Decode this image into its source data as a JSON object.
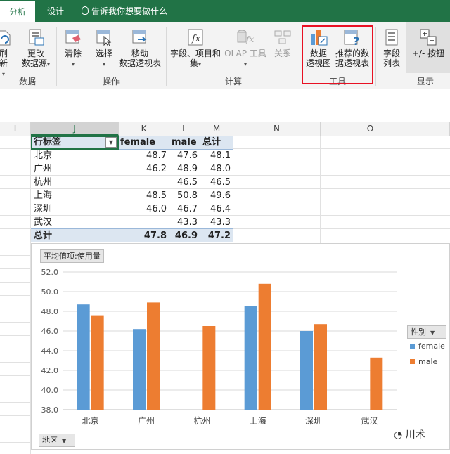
{
  "ribbon": {
    "tabs": {
      "analyze": "分析",
      "design": "设计"
    },
    "tell_me": "告诉我你想要做什么",
    "buttons": {
      "refresh": "刷新",
      "change_source_1": "更改",
      "change_source_2": "数据源",
      "clear": "清除",
      "select": "选择",
      "move_1": "移动",
      "move_2": "数据透视表",
      "fields_1": "字段、项目和",
      "fields_2": "集",
      "olap": "OLAP 工具",
      "relations": "关系",
      "pivot_chart_1": "数据",
      "pivot_chart_2": "透视图",
      "recommended_1": "推荐的数",
      "recommended_2": "据透视表",
      "field_list_1": "字段",
      "field_list_2": "列表",
      "plus_minus": "+/- 按钮"
    },
    "groups": {
      "data": "数据",
      "actions": "操作",
      "calculations": "计算",
      "tools": "工具",
      "show": "显示"
    }
  },
  "columns": [
    "I",
    "J",
    "K",
    "L",
    "M",
    "N",
    "O"
  ],
  "pivot": {
    "headers": {
      "row_label": "行标签",
      "female": "female",
      "male": "male",
      "total": "总计"
    },
    "rows": [
      {
        "city": "北京",
        "female": "48.7",
        "male": "47.6",
        "total": "48.1"
      },
      {
        "city": "广州",
        "female": "46.2",
        "male": "48.9",
        "total": "48.0"
      },
      {
        "city": "杭州",
        "female": "",
        "male": "46.5",
        "total": "46.5"
      },
      {
        "city": "上海",
        "female": "48.5",
        "male": "50.8",
        "total": "49.6"
      },
      {
        "city": "深圳",
        "female": "46.0",
        "male": "46.7",
        "total": "46.4"
      },
      {
        "city": "武汉",
        "female": "",
        "male": "43.3",
        "total": "43.3"
      }
    ],
    "total_row": {
      "label": "总计",
      "female": "47.8",
      "male": "46.9",
      "total": "47.2"
    }
  },
  "chart": {
    "value_field_button": "平均值项:使用量",
    "legend_field_button": "性别",
    "axis_field_button": "地区"
  },
  "chart_data": {
    "type": "bar",
    "categories": [
      "北京",
      "广州",
      "杭州",
      "上海",
      "深圳",
      "武汉"
    ],
    "series": [
      {
        "name": "female",
        "color": "#5b9bd5",
        "values": [
          48.7,
          46.2,
          null,
          48.5,
          46.0,
          null
        ]
      },
      {
        "name": "male",
        "color": "#ed7d31",
        "values": [
          47.6,
          48.9,
          46.5,
          50.8,
          46.7,
          43.3
        ]
      }
    ],
    "ylim": [
      38.0,
      52.0
    ],
    "yticks": [
      "38.0",
      "40.0",
      "42.0",
      "44.0",
      "46.0",
      "48.0",
      "50.0",
      "52.0"
    ],
    "grid": true,
    "legend_position": "right"
  },
  "watermark": "川术"
}
